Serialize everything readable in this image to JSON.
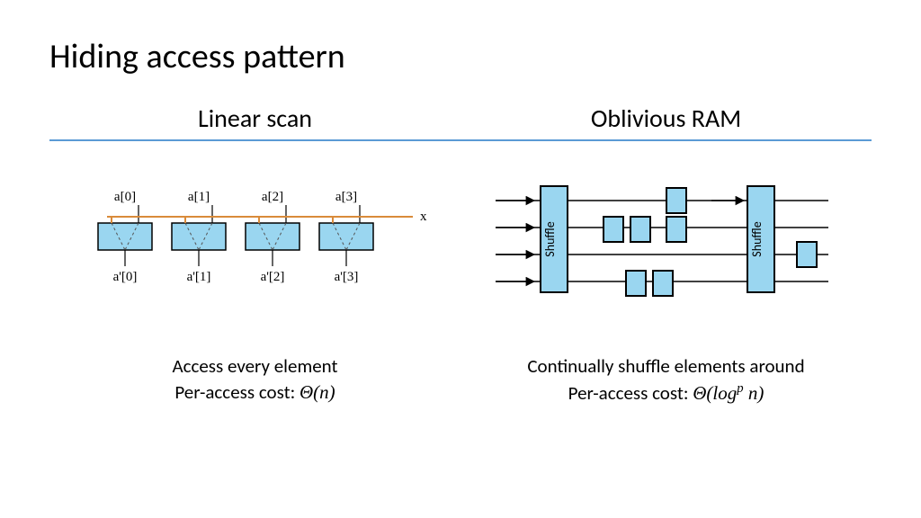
{
  "title": "Hiding access pattern",
  "left": {
    "heading": "Linear scan",
    "caption_line1": "Access every element",
    "caption_line2_prefix": "Per-access cost: ",
    "cost": "Θ(n)",
    "top_labels": [
      "a[0]",
      "a[1]",
      "a[2]",
      "a[3]"
    ],
    "bottom_labels": [
      "a'[0]",
      "a'[1]",
      "a'[2]",
      "a'[3]"
    ],
    "wire_label": "x"
  },
  "right": {
    "heading": "Oblivious RAM",
    "caption_line1": "Continually shuffle elements around",
    "caption_line2_prefix": "Per-access cost: ",
    "cost_html": "Θ(log<sup class='sup'>p</sup> n)",
    "shuffle_label": "Shuffle"
  },
  "colors": {
    "box_fill": "#9ad6f0",
    "box_stroke": "#000",
    "wire": "#d98b3a",
    "divider": "#5b9bd5"
  }
}
